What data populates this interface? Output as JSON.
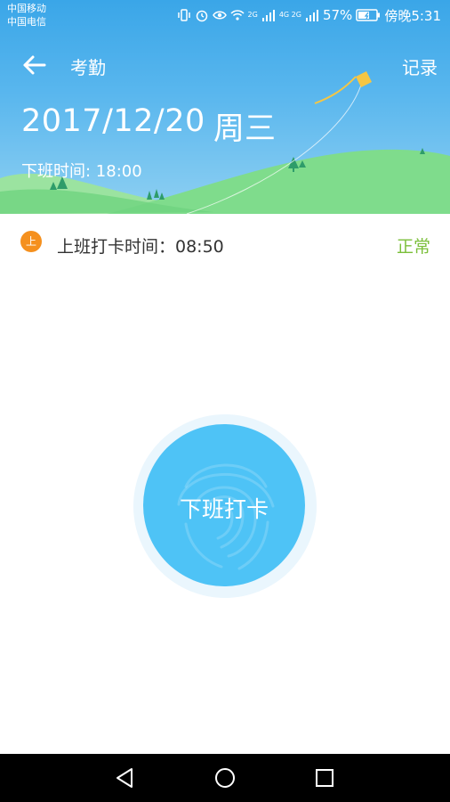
{
  "status_bar": {
    "carrier_1": "中国移动",
    "carrier_2": "中国电信",
    "net_label_1": "2G",
    "net_label_2": "4G 2G",
    "battery": "57%",
    "time": "傍晚5:31"
  },
  "app_bar": {
    "back_icon": "arrow-left-icon",
    "title": "考勤",
    "record_link": "记录"
  },
  "header": {
    "date": "2017/12/20",
    "weekday": "周三",
    "off_work_time": "下班时间: 18:00"
  },
  "checkin_record": {
    "badge": "上",
    "label": "上班打卡时间：08:50",
    "status": "正常"
  },
  "punch_button": {
    "label": "下班打卡",
    "icon": "fingerprint-icon"
  },
  "nav_bar": {
    "back": "triangle-back-icon",
    "home": "circle-home-icon",
    "recents": "square-recents-icon"
  },
  "colors": {
    "header_top": "#3aa6e8",
    "hill_green": "#7fdc8c",
    "badge_orange": "#f5901e",
    "status_green": "#7bbf3a",
    "punch_blue": "#4ec3f6"
  }
}
